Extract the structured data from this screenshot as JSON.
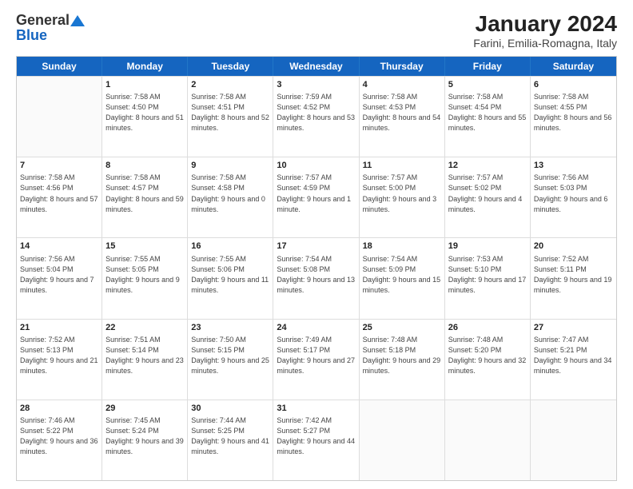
{
  "logo": {
    "general": "General",
    "blue": "Blue"
  },
  "title": "January 2024",
  "subtitle": "Farini, Emilia-Romagna, Italy",
  "days": [
    "Sunday",
    "Monday",
    "Tuesday",
    "Wednesday",
    "Thursday",
    "Friday",
    "Saturday"
  ],
  "weeks": [
    [
      {
        "num": "",
        "sunrise": "",
        "sunset": "",
        "daylight": "",
        "empty": true
      },
      {
        "num": "1",
        "sunrise": "Sunrise: 7:58 AM",
        "sunset": "Sunset: 4:50 PM",
        "daylight": "Daylight: 8 hours and 51 minutes."
      },
      {
        "num": "2",
        "sunrise": "Sunrise: 7:58 AM",
        "sunset": "Sunset: 4:51 PM",
        "daylight": "Daylight: 8 hours and 52 minutes."
      },
      {
        "num": "3",
        "sunrise": "Sunrise: 7:59 AM",
        "sunset": "Sunset: 4:52 PM",
        "daylight": "Daylight: 8 hours and 53 minutes."
      },
      {
        "num": "4",
        "sunrise": "Sunrise: 7:58 AM",
        "sunset": "Sunset: 4:53 PM",
        "daylight": "Daylight: 8 hours and 54 minutes."
      },
      {
        "num": "5",
        "sunrise": "Sunrise: 7:58 AM",
        "sunset": "Sunset: 4:54 PM",
        "daylight": "Daylight: 8 hours and 55 minutes."
      },
      {
        "num": "6",
        "sunrise": "Sunrise: 7:58 AM",
        "sunset": "Sunset: 4:55 PM",
        "daylight": "Daylight: 8 hours and 56 minutes."
      }
    ],
    [
      {
        "num": "7",
        "sunrise": "Sunrise: 7:58 AM",
        "sunset": "Sunset: 4:56 PM",
        "daylight": "Daylight: 8 hours and 57 minutes."
      },
      {
        "num": "8",
        "sunrise": "Sunrise: 7:58 AM",
        "sunset": "Sunset: 4:57 PM",
        "daylight": "Daylight: 8 hours and 59 minutes."
      },
      {
        "num": "9",
        "sunrise": "Sunrise: 7:58 AM",
        "sunset": "Sunset: 4:58 PM",
        "daylight": "Daylight: 9 hours and 0 minutes."
      },
      {
        "num": "10",
        "sunrise": "Sunrise: 7:57 AM",
        "sunset": "Sunset: 4:59 PM",
        "daylight": "Daylight: 9 hours and 1 minute."
      },
      {
        "num": "11",
        "sunrise": "Sunrise: 7:57 AM",
        "sunset": "Sunset: 5:00 PM",
        "daylight": "Daylight: 9 hours and 3 minutes."
      },
      {
        "num": "12",
        "sunrise": "Sunrise: 7:57 AM",
        "sunset": "Sunset: 5:02 PM",
        "daylight": "Daylight: 9 hours and 4 minutes."
      },
      {
        "num": "13",
        "sunrise": "Sunrise: 7:56 AM",
        "sunset": "Sunset: 5:03 PM",
        "daylight": "Daylight: 9 hours and 6 minutes."
      }
    ],
    [
      {
        "num": "14",
        "sunrise": "Sunrise: 7:56 AM",
        "sunset": "Sunset: 5:04 PM",
        "daylight": "Daylight: 9 hours and 7 minutes."
      },
      {
        "num": "15",
        "sunrise": "Sunrise: 7:55 AM",
        "sunset": "Sunset: 5:05 PM",
        "daylight": "Daylight: 9 hours and 9 minutes."
      },
      {
        "num": "16",
        "sunrise": "Sunrise: 7:55 AM",
        "sunset": "Sunset: 5:06 PM",
        "daylight": "Daylight: 9 hours and 11 minutes."
      },
      {
        "num": "17",
        "sunrise": "Sunrise: 7:54 AM",
        "sunset": "Sunset: 5:08 PM",
        "daylight": "Daylight: 9 hours and 13 minutes."
      },
      {
        "num": "18",
        "sunrise": "Sunrise: 7:54 AM",
        "sunset": "Sunset: 5:09 PM",
        "daylight": "Daylight: 9 hours and 15 minutes."
      },
      {
        "num": "19",
        "sunrise": "Sunrise: 7:53 AM",
        "sunset": "Sunset: 5:10 PM",
        "daylight": "Daylight: 9 hours and 17 minutes."
      },
      {
        "num": "20",
        "sunrise": "Sunrise: 7:52 AM",
        "sunset": "Sunset: 5:11 PM",
        "daylight": "Daylight: 9 hours and 19 minutes."
      }
    ],
    [
      {
        "num": "21",
        "sunrise": "Sunrise: 7:52 AM",
        "sunset": "Sunset: 5:13 PM",
        "daylight": "Daylight: 9 hours and 21 minutes."
      },
      {
        "num": "22",
        "sunrise": "Sunrise: 7:51 AM",
        "sunset": "Sunset: 5:14 PM",
        "daylight": "Daylight: 9 hours and 23 minutes."
      },
      {
        "num": "23",
        "sunrise": "Sunrise: 7:50 AM",
        "sunset": "Sunset: 5:15 PM",
        "daylight": "Daylight: 9 hours and 25 minutes."
      },
      {
        "num": "24",
        "sunrise": "Sunrise: 7:49 AM",
        "sunset": "Sunset: 5:17 PM",
        "daylight": "Daylight: 9 hours and 27 minutes."
      },
      {
        "num": "25",
        "sunrise": "Sunrise: 7:48 AM",
        "sunset": "Sunset: 5:18 PM",
        "daylight": "Daylight: 9 hours and 29 minutes."
      },
      {
        "num": "26",
        "sunrise": "Sunrise: 7:48 AM",
        "sunset": "Sunset: 5:20 PM",
        "daylight": "Daylight: 9 hours and 32 minutes."
      },
      {
        "num": "27",
        "sunrise": "Sunrise: 7:47 AM",
        "sunset": "Sunset: 5:21 PM",
        "daylight": "Daylight: 9 hours and 34 minutes."
      }
    ],
    [
      {
        "num": "28",
        "sunrise": "Sunrise: 7:46 AM",
        "sunset": "Sunset: 5:22 PM",
        "daylight": "Daylight: 9 hours and 36 minutes."
      },
      {
        "num": "29",
        "sunrise": "Sunrise: 7:45 AM",
        "sunset": "Sunset: 5:24 PM",
        "daylight": "Daylight: 9 hours and 39 minutes."
      },
      {
        "num": "30",
        "sunrise": "Sunrise: 7:44 AM",
        "sunset": "Sunset: 5:25 PM",
        "daylight": "Daylight: 9 hours and 41 minutes."
      },
      {
        "num": "31",
        "sunrise": "Sunrise: 7:42 AM",
        "sunset": "Sunset: 5:27 PM",
        "daylight": "Daylight: 9 hours and 44 minutes."
      },
      {
        "num": "",
        "sunrise": "",
        "sunset": "",
        "daylight": "",
        "empty": true
      },
      {
        "num": "",
        "sunrise": "",
        "sunset": "",
        "daylight": "",
        "empty": true
      },
      {
        "num": "",
        "sunrise": "",
        "sunset": "",
        "daylight": "",
        "empty": true
      }
    ]
  ]
}
